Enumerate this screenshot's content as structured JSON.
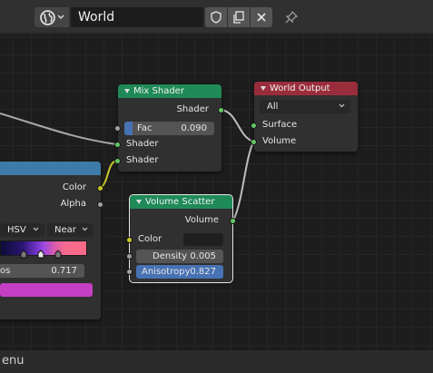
{
  "header": {
    "world_name": "World",
    "world_type_icon": "globe-icon",
    "fake_user_icon": "shield-icon",
    "duplicate_icon": "duplicate-icon",
    "unlink_icon": "close-icon",
    "pin_icon": "pin-icon"
  },
  "nodes": {
    "mix_shader": {
      "title": "Mix Shader",
      "output": "Shader",
      "fac_label": "Fac",
      "fac_value": "0.090",
      "fac_fraction": 0.09,
      "input1": "Shader",
      "input2": "Shader"
    },
    "world_output": {
      "title": "World Output",
      "target": "All",
      "surface": "Surface",
      "volume": "Volume"
    },
    "volume_scatter": {
      "title": "Volume Scatter",
      "output": "Volume",
      "color_label": "Color",
      "density_label": "Density",
      "density_value": "0.005",
      "anisotropy_label": "Anisotropy",
      "anisotropy_value": "0.827"
    },
    "color_ramp": {
      "color_out": "Color",
      "alpha_out": "Alpha",
      "color_mode": "HSV",
      "interpolation": "Near",
      "pos_label_fragment": "os",
      "pos_value": "0.717",
      "active_color": "#c43fc3"
    }
  },
  "statusbar": {
    "text": "enu"
  },
  "colors": {
    "socket_shader": "#63c763",
    "socket_color": "#c7c729",
    "socket_float": "#a1a1a1",
    "header_shader": "#1f8a58",
    "header_output": "#9a2d3c",
    "header_converter": "#3f7ba8"
  }
}
